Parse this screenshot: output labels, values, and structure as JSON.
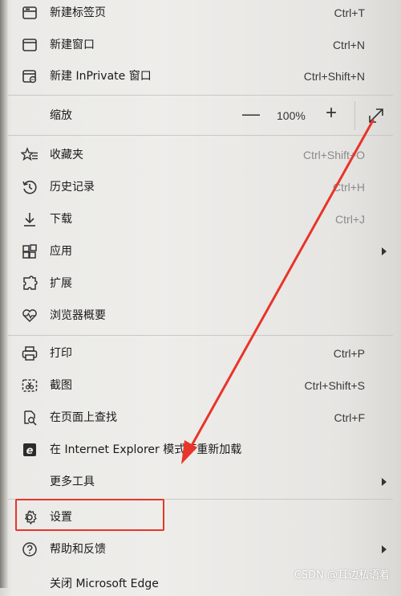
{
  "menu": {
    "new_tab": {
      "label": "新建标签页",
      "shortcut": "Ctrl+T",
      "icon": "new-tab-icon"
    },
    "new_window": {
      "label": "新建窗口",
      "shortcut": "Ctrl+N",
      "icon": "new-window-icon"
    },
    "new_inprivate": {
      "label": "新建 InPrivate 窗口",
      "shortcut": "Ctrl+Shift+N",
      "icon": "inprivate-icon"
    },
    "zoom": {
      "label": "缩放",
      "minus": "—",
      "value": "100%",
      "plus": "+",
      "icon": "fullscreen-icon"
    },
    "favorites": {
      "label": "收藏夹",
      "shortcut": "Ctrl+Shift+O",
      "icon": "favorites-icon"
    },
    "history": {
      "label": "历史记录",
      "shortcut": "Ctrl+H",
      "icon": "history-icon"
    },
    "downloads": {
      "label": "下载",
      "shortcut": "Ctrl+J",
      "icon": "download-icon"
    },
    "apps": {
      "label": "应用",
      "icon": "apps-icon"
    },
    "extensions": {
      "label": "扩展",
      "icon": "extensions-icon"
    },
    "browser_essentials": {
      "label": "浏览器概要",
      "icon": "heart-pulse-icon"
    },
    "print": {
      "label": "打印",
      "shortcut": "Ctrl+P",
      "icon": "print-icon"
    },
    "screenshot": {
      "label": "截图",
      "shortcut": "Ctrl+Shift+S",
      "icon": "screenshot-icon"
    },
    "find": {
      "label": "在页面上查找",
      "shortcut": "Ctrl+F",
      "icon": "find-icon"
    },
    "ie_mode": {
      "label": "在 Internet Explorer 模式下重新加载",
      "icon": "ie-icon"
    },
    "more_tools": {
      "label": "更多工具"
    },
    "settings": {
      "label": "设置",
      "icon": "gear-icon"
    },
    "help": {
      "label": "帮助和反馈",
      "icon": "help-icon"
    },
    "close_edge": {
      "label": "关闭 Microsoft Edge"
    }
  },
  "annotation": {
    "color": "#e8342a"
  },
  "watermark": "CSDN @耳边私语着"
}
